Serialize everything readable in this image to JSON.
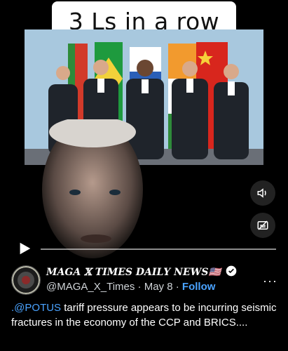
{
  "video": {
    "caption": "3 Ls in a row"
  },
  "controls": {
    "volume_icon": "volume-icon",
    "captions_icon": "captions-icon",
    "play_icon": "play-icon"
  },
  "post": {
    "display_name": "𝑴𝑨𝑮𝑨 𝕏 𝑻𝑰𝑴𝑬𝑺 𝑫𝑨𝑰𝑳𝒀 𝑵𝑬𝑾𝑺",
    "flag": "🇺🇸",
    "handle": "@MAGA_X_Times",
    "separator": "·",
    "date": "May 8",
    "follow_label": "Follow",
    "more_label": "···",
    "text_mention": ".@POTUS",
    "text_body": " tariff pressure appears to be incurring seismic fractures in the economy of the CCP and BRICS...."
  },
  "colors": {
    "accent": "#4aa3ff",
    "background": "#000000"
  }
}
